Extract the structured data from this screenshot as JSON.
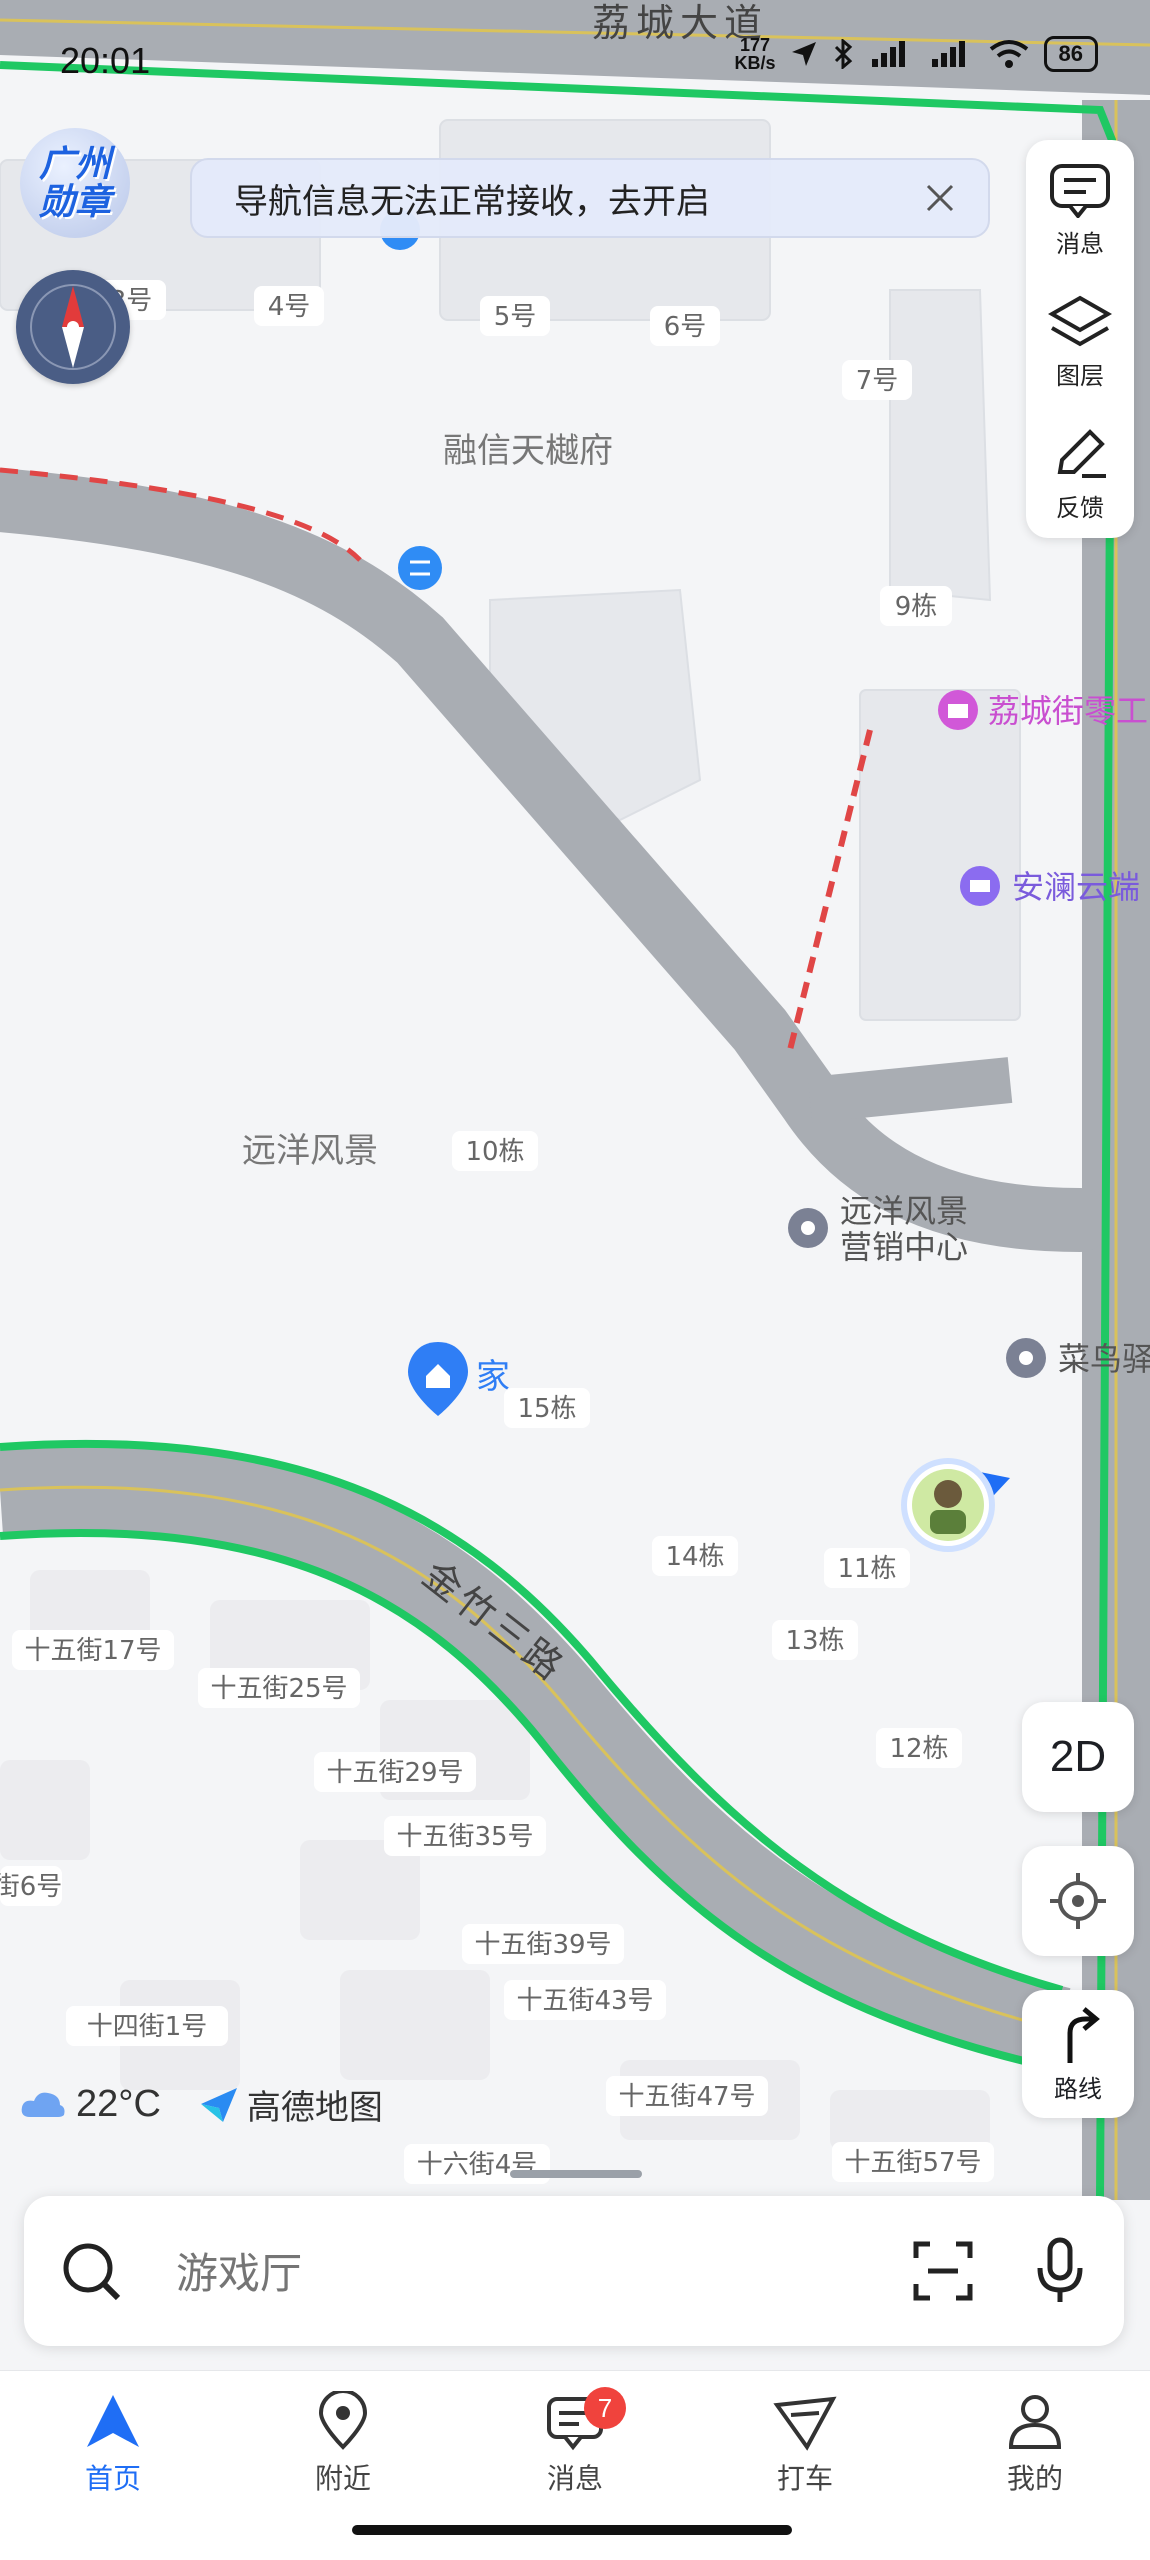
{
  "status_bar": {
    "time": "20:01",
    "net_speed_value": "177",
    "net_speed_unit": "KB/s",
    "battery": "86"
  },
  "nav_banner": {
    "text": "导航信息无法正常接收，去开启"
  },
  "badge_logo": {
    "line1": "广州",
    "line2": "勋章"
  },
  "side_panel": {
    "messages": "消息",
    "layers": "图层",
    "feedback": "反馈"
  },
  "controls": {
    "mode": "2D",
    "route": "路线"
  },
  "weather": {
    "temp": "22°C",
    "brand": "高德地图"
  },
  "search": {
    "placeholder": "游戏厅"
  },
  "tabbar": {
    "items": [
      {
        "label": "首页"
      },
      {
        "label": "附近"
      },
      {
        "label": "消息",
        "badge": "7"
      },
      {
        "label": "打车"
      },
      {
        "label": "我的"
      }
    ]
  },
  "map": {
    "road_top": "荔城大道",
    "road_main": "金竹三路",
    "places": {
      "complex": "融信天樾府",
      "area": "远洋风景",
      "sales_line1": "远洋风景",
      "sales_line2": "营销中心",
      "home": "家",
      "poi_shop": "荔城街零工",
      "poi_hotel": "安澜云端",
      "poi_cainiao": "菜鸟驿"
    },
    "buildings": [
      "3号",
      "4号",
      "5号",
      "6号",
      "7号",
      "9栋",
      "10栋",
      "15栋",
      "14栋",
      "11栋",
      "13栋",
      "12栋",
      "十五街17号",
      "十五街25号",
      "十五街29号",
      "十五街35号",
      "街6号",
      "十五街39号",
      "十五街43号",
      "十四街1号",
      "十五街47号",
      "十六街4号",
      "十五街57号"
    ]
  },
  "colors": {
    "accent": "#1f6ef5",
    "route_green": "#1fc863",
    "road": "#a9adb3",
    "poi_pink": "#d158d8"
  }
}
